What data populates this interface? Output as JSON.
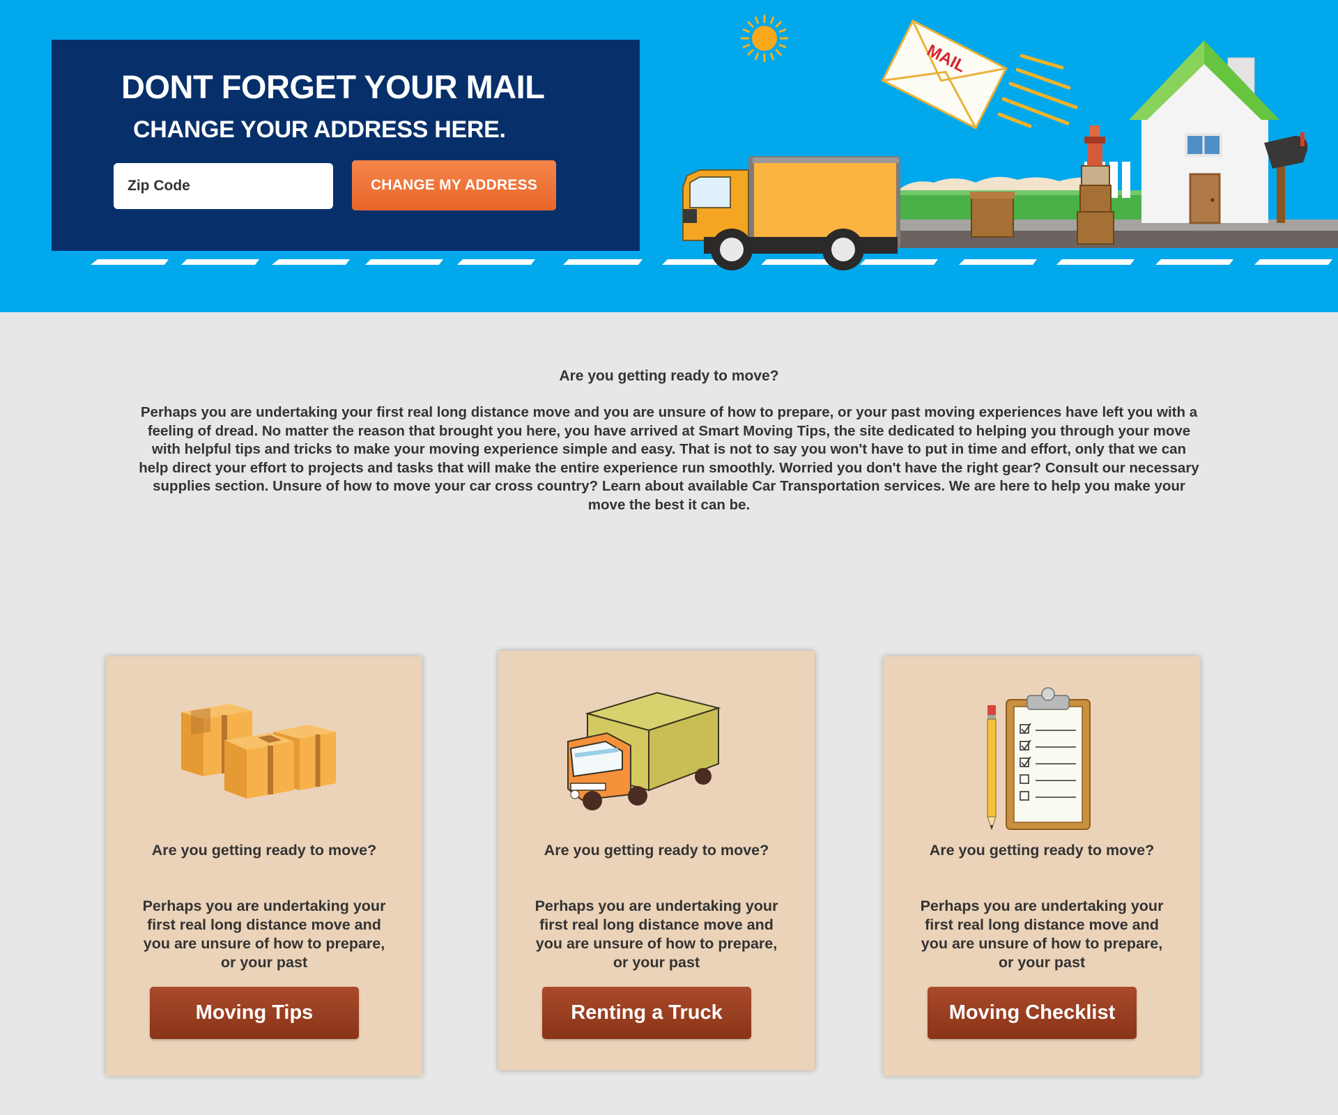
{
  "hero": {
    "title": "DONT FORGET YOUR MAIL",
    "subtitle": "CHANGE YOUR ADDRESS HERE.",
    "zip_placeholder": "Zip Code",
    "button_label": "CHANGE MY ADDRESS",
    "envelope_label": "MAIL",
    "bg_color": "#01a8ec",
    "box_color": "#07306b",
    "button_color": "#f07a3e"
  },
  "intro": {
    "heading": "Are you getting ready to move?",
    "body": "Perhaps you are undertaking your first real long distance move and you are unsure of how to prepare, or your past moving experiences have left you with a feeling of dread.  No matter the reason that brought you here, you have arrived at Smart Moving Tips, the site dedicated to helping you through your move with helpful tips and tricks to make your moving experience simple and easy.  That is not to say you won't have to put in time and effort, only that we can help direct your effort to projects and tasks that will make the entire experience run smoothly.  Worried you don't have the right gear? Consult our necessary supplies section.  Unsure of how to move your car cross country?  Learn about available Car Transportation services.  We are here to help you make your move the best it can be."
  },
  "cards": [
    {
      "icon": "boxes-icon",
      "heading": "Are you getting ready to move?",
      "text": "Perhaps you are undertaking your first real long distance move and you are unsure of how to prepare, or your past",
      "button": "Moving Tips"
    },
    {
      "icon": "truck-icon",
      "heading": "Are you getting ready to move?",
      "text": "Perhaps you are undertaking your first real long distance move and you are unsure of how to prepare, or your past",
      "button": "Renting a Truck"
    },
    {
      "icon": "checklist-icon",
      "heading": "Are you getting ready to move?",
      "text": "Perhaps you are undertaking your first real long distance move and you are unsure of how to prepare, or your past",
      "button": "Moving Checklist"
    }
  ],
  "colors": {
    "page_bg": "#e7e7e7",
    "card_bg": "#ebd3b9",
    "card_button": "#9a3f20",
    "text": "#333333"
  }
}
